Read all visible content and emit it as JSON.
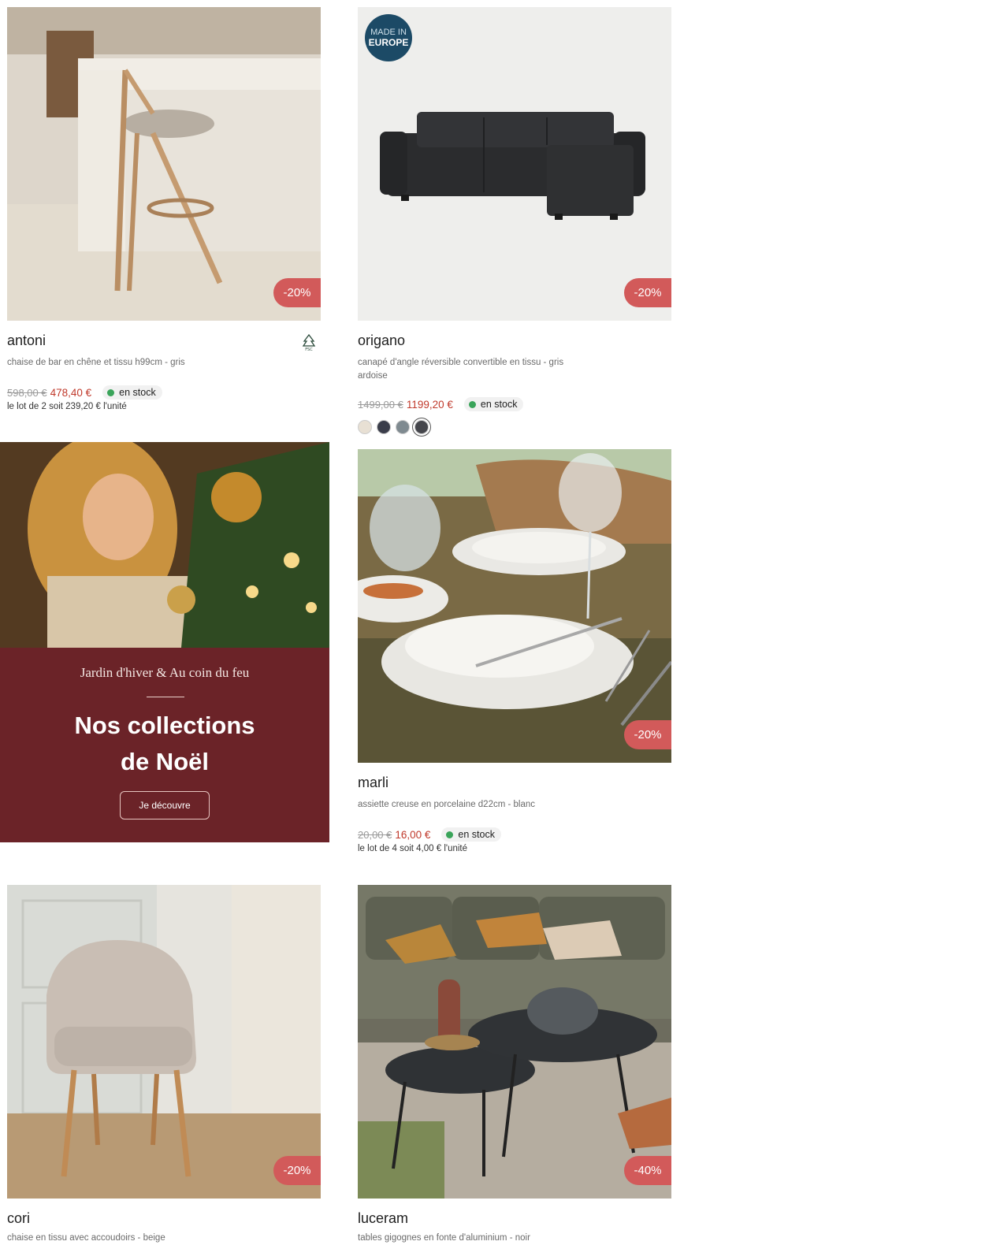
{
  "products": [
    {
      "name": "antoni",
      "description": "chaise de bar en chêne et tissu h99cm - gris",
      "discount": "-20%",
      "old_price": "598,00 €",
      "new_price": "478,40 €",
      "stock": "en stock",
      "lot": "le lot de 2 soit 239,20 € l'unité",
      "eco_label": "FSC"
    },
    {
      "name": "origano",
      "description": "canapé d'angle réversible convertible en tissu - gris ardoise",
      "discount": "-20%",
      "badge_line1": "MADE IN",
      "badge_line2": "EUROPE",
      "old_price": "1499,00 €",
      "new_price": "1199,20 €",
      "stock": "en stock",
      "swatches": [
        "#e8e0d4",
        "#3a3d4a",
        "#7f8a90",
        "#45464c"
      ]
    },
    {
      "name": "marli",
      "description": "assiette creuse en porcelaine d22cm - blanc",
      "discount": "-20%",
      "old_price": "20,00 €",
      "new_price": "16,00 €",
      "stock": "en stock",
      "lot": "le lot de 4 soit 4,00 € l'unité"
    },
    {
      "name": "cori",
      "description": "chaise en tissu avec accoudoirs - beige",
      "discount": "-20%"
    },
    {
      "name": "luceram",
      "description": "tables gigognes en fonte d'aluminium - noir",
      "discount": "-40%"
    }
  ],
  "promo": {
    "subtitle": "Jardin d'hiver & Au coin du feu",
    "title_line1": "Nos collections",
    "title_line2": "de Noël",
    "button": "Je découvre"
  },
  "colors": {
    "discount_badge": "#d25a5a",
    "price": "#c0392b",
    "stock_dot": "#3aa45a",
    "promo_bg": "#6b2328"
  }
}
